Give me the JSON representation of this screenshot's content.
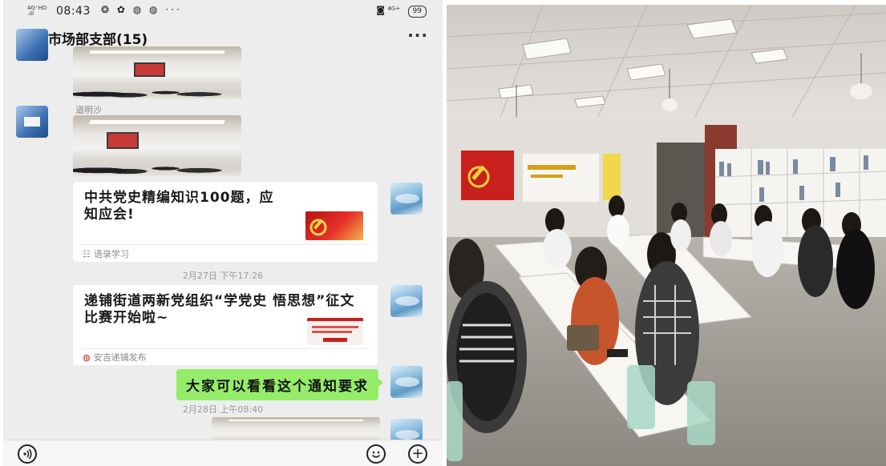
{
  "status_bar": {
    "signal": "4G⁺HD\n.ıll",
    "time": "08:43",
    "notification_icons": "❂ ✿ ◍ ◍ ···",
    "right_icons": "◙ ⁴ᴳ⁺",
    "battery": "99"
  },
  "header": {
    "back_glyph": "<",
    "title": "市场部支部(15)",
    "more_glyph": "···"
  },
  "messages": {
    "sender_name": "道明沙",
    "card1": {
      "title": "中共党史精编知识100题，应知应会!",
      "source": "语录学习"
    },
    "timestamp1": "2月27日 下午17:26",
    "card2": {
      "title": "递铺街道两新党组织“学党史 悟思想”征文比赛开始啦~",
      "source": "安吉递铺发布"
    },
    "bubble_text": "大家可以看看这个通知要求",
    "timestamp2": "2月28日 上午08:40"
  },
  "input_bar": {
    "voice_icon": "voice-icon",
    "emoji_icon": "emoji-icon",
    "add_icon": "add-icon"
  },
  "colors": {
    "chat_bg": "#ededed",
    "bubble_green": "#95ec69",
    "party_red": "#c8201c",
    "wall_white": "#e9e7e2"
  }
}
